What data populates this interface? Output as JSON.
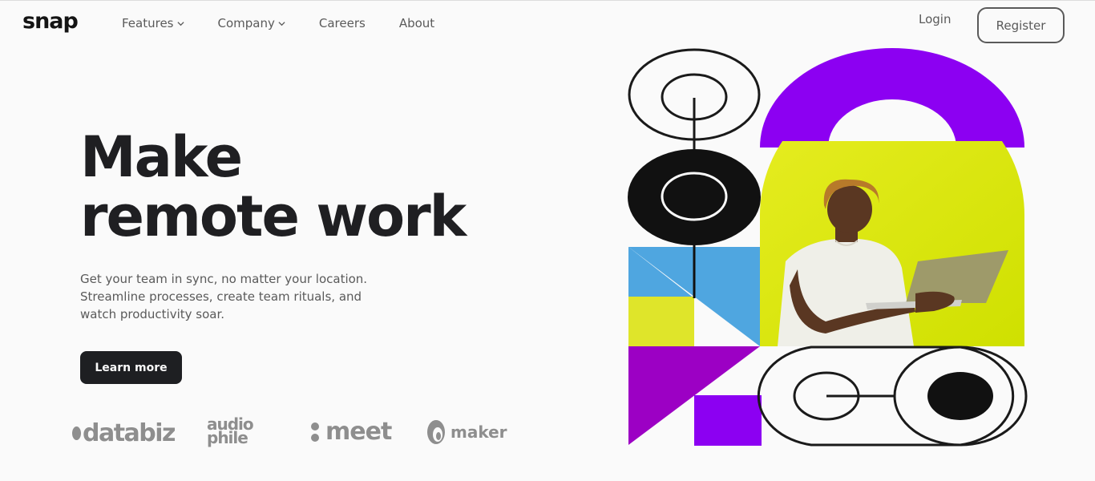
{
  "brand": {
    "logo": "snap"
  },
  "nav": {
    "items": [
      {
        "label": "Features",
        "has_dropdown": true
      },
      {
        "label": "Company",
        "has_dropdown": true
      },
      {
        "label": "Careers",
        "has_dropdown": false
      },
      {
        "label": "About",
        "has_dropdown": false
      }
    ],
    "login_label": "Login",
    "register_label": "Register"
  },
  "hero": {
    "title_line1": "Make",
    "title_line2": "remote work",
    "description": "Get your team in sync, no matter your location. Streamline processes, create team rituals, and watch productivity soar.",
    "cta_label": "Learn more"
  },
  "clients": {
    "databiz": "databiz",
    "audiophile_line1": "audio",
    "audiophile_line2": "phile",
    "meet": "meet",
    "maker": "maker"
  },
  "colors": {
    "purple": "#8c00f2",
    "magenta": "#9c00c4",
    "blue": "#4fa6e0",
    "yellow": "#dfe21a",
    "dark": "#141414",
    "grey_text": "#5a5a5a"
  }
}
